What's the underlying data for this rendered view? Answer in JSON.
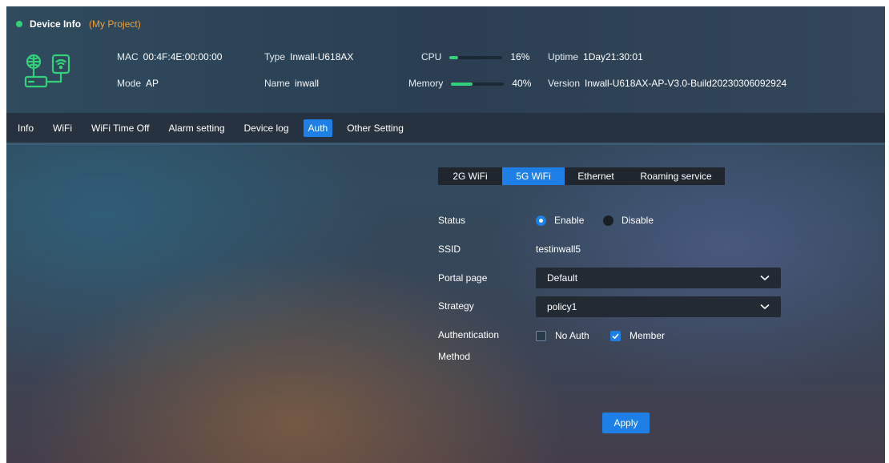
{
  "header": {
    "title": "Device Info",
    "project": "(My Project)",
    "mac": {
      "label": "MAC",
      "value": "00:4F:4E:00:00:00"
    },
    "mode": {
      "label": "Mode",
      "value": "AP"
    },
    "type": {
      "label": "Type",
      "value": "Inwall-U618AX"
    },
    "name": {
      "label": "Name",
      "value": "inwall"
    },
    "cpu": {
      "label": "CPU",
      "value": "16%",
      "level": 0.16
    },
    "memory": {
      "label": "Memory",
      "value": "40%",
      "level": 0.4
    },
    "uptime": {
      "label": "Uptime",
      "value": "1Day21:30:01"
    },
    "version": {
      "label": "Version",
      "value": "Inwall-U618AX-AP-V3.0-Build20230306092924"
    },
    "device_icon": "router-ap-icon",
    "status_color": "#33d17a"
  },
  "nav": {
    "tabs": [
      "Info",
      "WiFi",
      "WiFi Time Off",
      "Alarm setting",
      "Device log",
      "Auth",
      "Other Setting"
    ],
    "active": "Auth"
  },
  "subtabs": {
    "items": [
      "2G WiFi",
      "5G WiFi",
      "Ethernet",
      "Roaming service"
    ],
    "active": "5G WiFi"
  },
  "form": {
    "status": {
      "label": "Status",
      "enable": "Enable",
      "disable": "Disable",
      "selected": "Enable"
    },
    "ssid": {
      "label": "SSID",
      "value": "testinwall5"
    },
    "portal": {
      "label": "Portal page",
      "value": "Default"
    },
    "strategy": {
      "label": "Strategy",
      "value": "policy1"
    },
    "auth_method": {
      "label_line1": "Authentication",
      "label_line2": "Method",
      "no_auth": {
        "label": "No Auth",
        "checked": false
      },
      "member": {
        "label": "Member",
        "checked": true
      }
    },
    "apply_label": "Apply"
  },
  "colors": {
    "accent": "#1e7fe6",
    "project": "#f0a030",
    "status": "#33d17a"
  }
}
